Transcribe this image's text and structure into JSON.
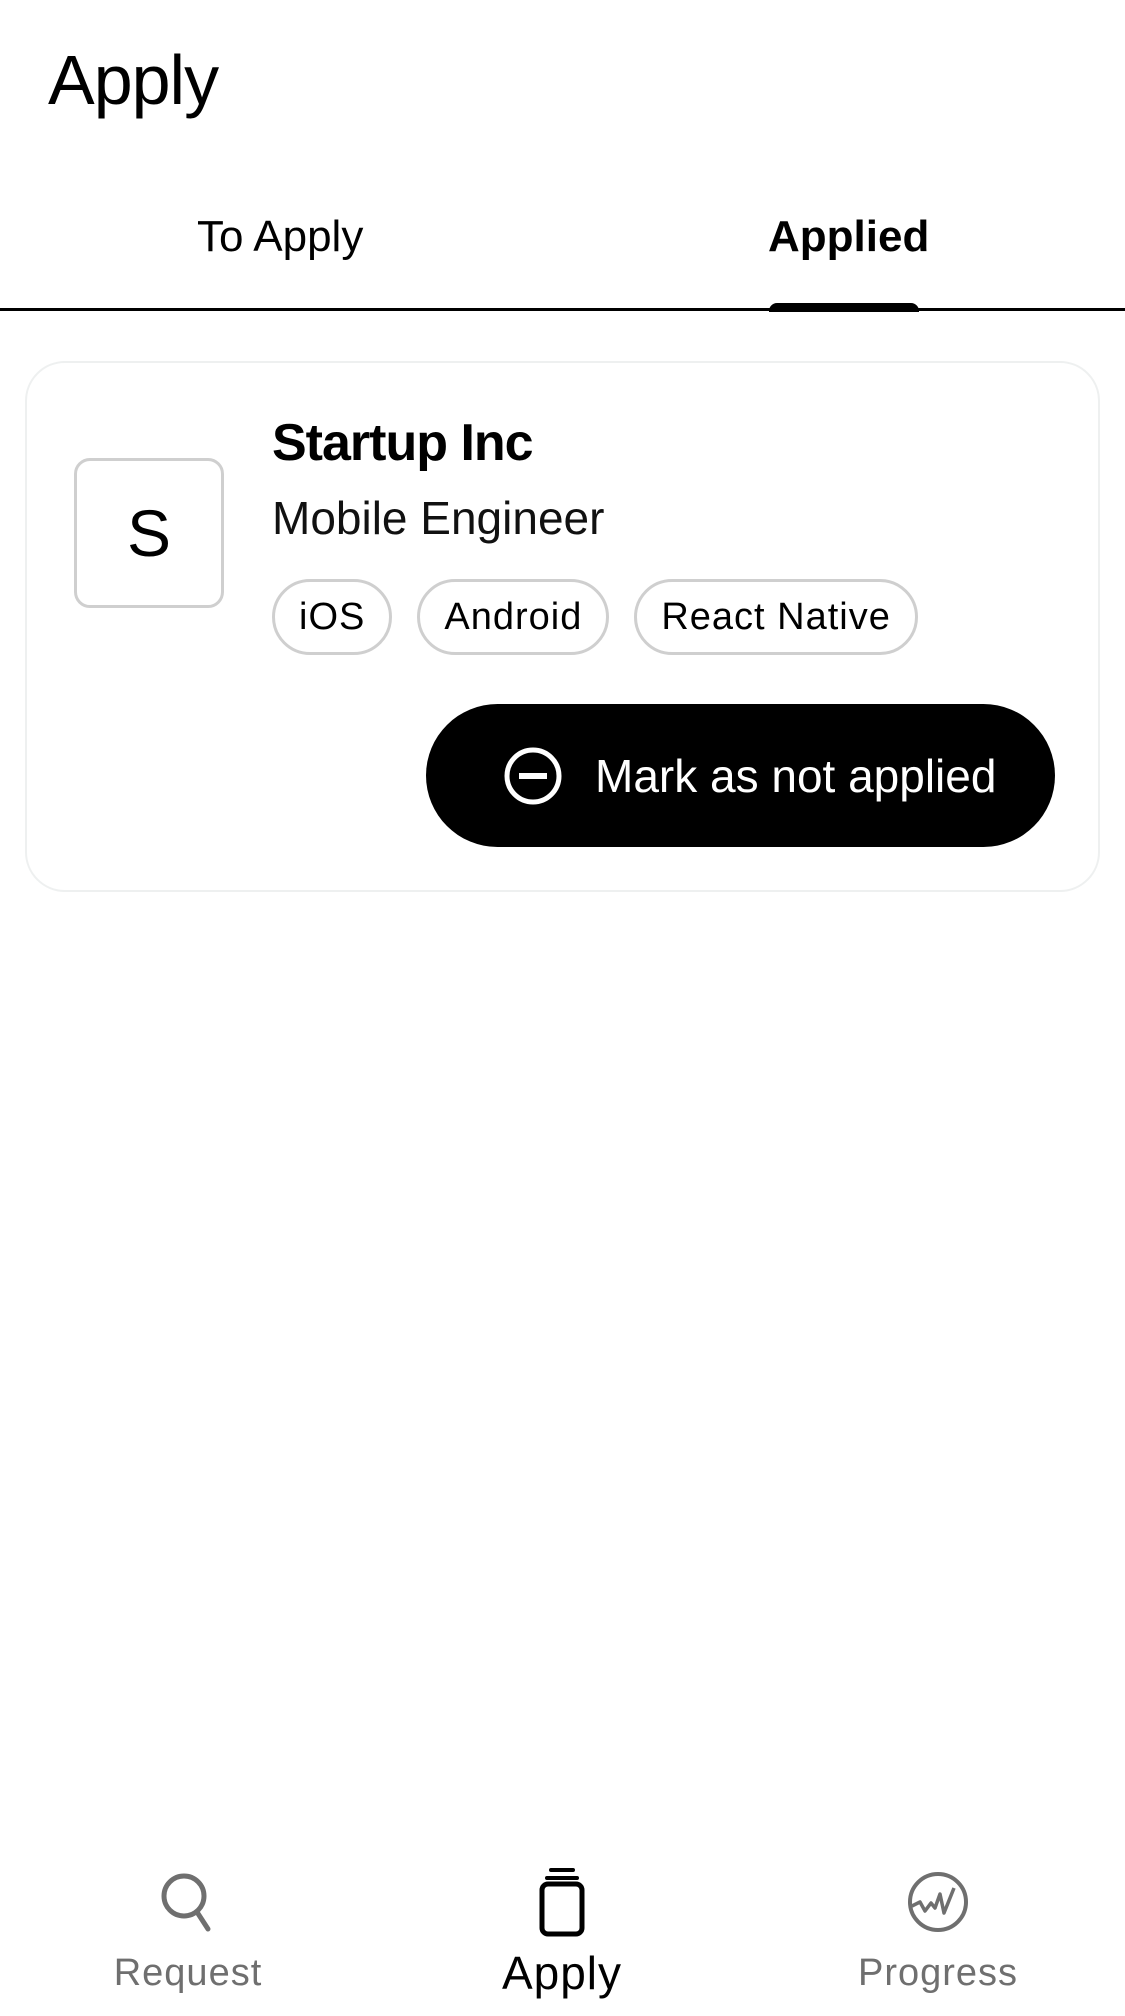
{
  "header": {
    "title": "Apply"
  },
  "tabs": [
    {
      "label": "To Apply",
      "active": false
    },
    {
      "label": "Applied",
      "active": true
    }
  ],
  "card": {
    "logo_letter": "S",
    "company": "Startup Inc",
    "role": "Mobile Engineer",
    "tags": [
      "iOS",
      "Android",
      "React Native"
    ],
    "action": {
      "label": "Mark as not applied",
      "icon": "minus-circle-icon"
    }
  },
  "bottom_nav": [
    {
      "label": "Request",
      "icon": "search-icon",
      "active": false
    },
    {
      "label": "Apply",
      "icon": "stack-icon",
      "active": true
    },
    {
      "label": "Progress",
      "icon": "progress-chart-icon",
      "active": false
    }
  ],
  "colors": {
    "primary": "#000000",
    "inactive": "#6f6f6f",
    "border": "#cfcfcf",
    "card_border": "#eef0f0"
  }
}
